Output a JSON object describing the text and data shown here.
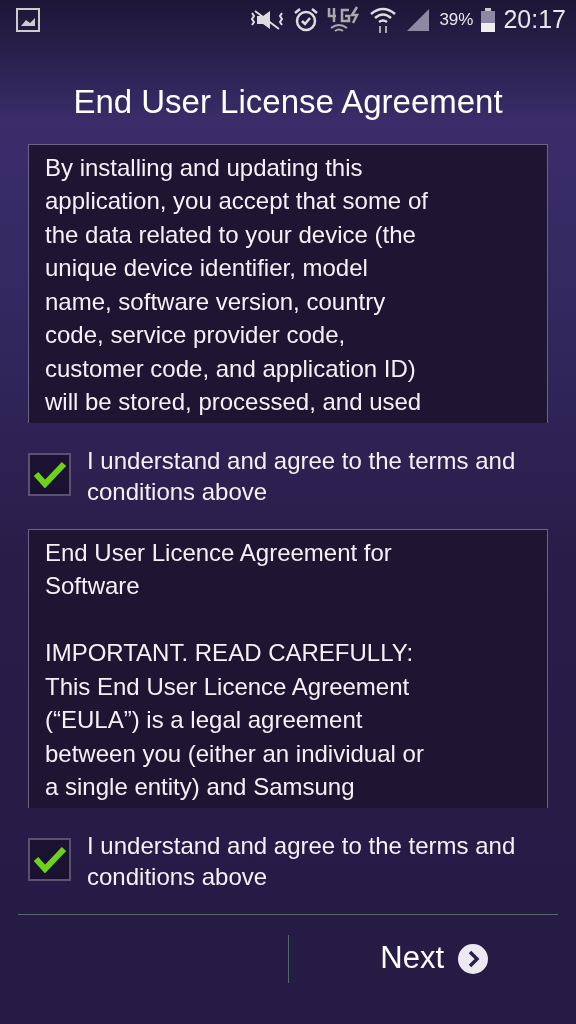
{
  "status_bar": {
    "battery_percent": "39%",
    "time": "20:17"
  },
  "title": "End User License Agreement",
  "agreements": [
    {
      "text": "By installing and updating this\napplication, you accept that some of\nthe data related to your device (the\nunique device identifier, model\nname, software version, country\ncode, service provider code,\ncustomer code, and application ID)\nwill be stored, processed, and used",
      "checkbox": {
        "label": "I understand and agree to the terms and conditions above",
        "checked": true
      }
    },
    {
      "text": "End User Licence Agreement for\nSoftware\n\n IMPORTANT. READ CAREFULLY:\nThis End User Licence Agreement\n(“EULA”) is a legal agreement\nbetween you (either an individual or\na single entity) and Samsung",
      "checkbox": {
        "label": "I understand and agree to the terms and conditions above",
        "checked": true
      }
    }
  ],
  "next_button": {
    "label": "Next"
  }
}
